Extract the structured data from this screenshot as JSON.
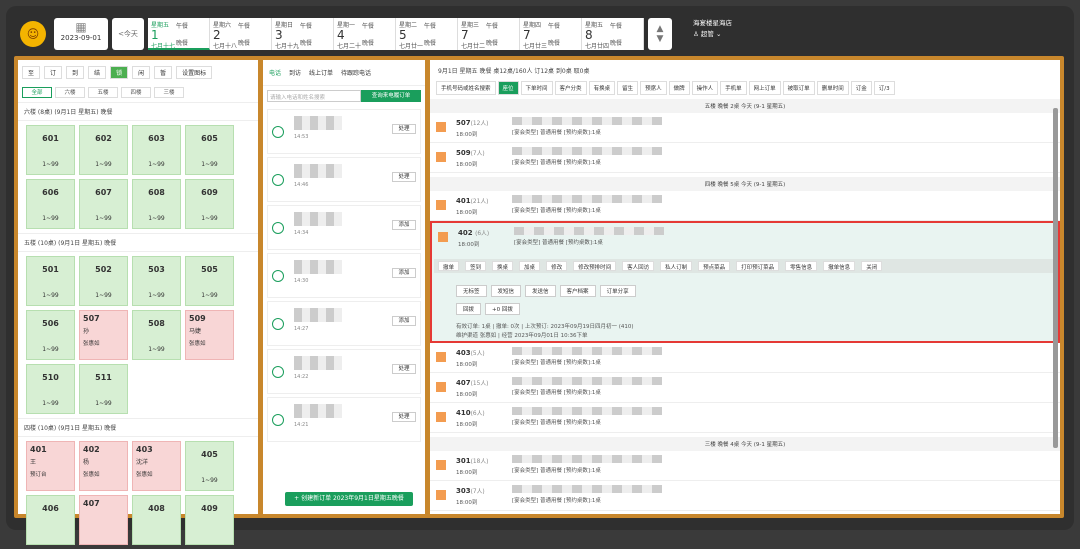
{
  "date": "2023-09-01",
  "today_label": "<今天",
  "days": [
    {
      "wk": "星期五",
      "num": "1",
      "lun": "七月十七",
      "m1": "午餐",
      "m2": "晚餐",
      "active": true
    },
    {
      "wk": "星期六",
      "num": "2",
      "lun": "七月十八",
      "m1": "午餐",
      "m2": "晚餐"
    },
    {
      "wk": "星期日",
      "num": "3",
      "lun": "七月十九",
      "m1": "午餐",
      "m2": "晚餐"
    },
    {
      "wk": "星期一",
      "num": "4",
      "lun": "七月二十",
      "m1": "午餐",
      "m2": "晚餐"
    },
    {
      "wk": "星期二",
      "num": "5",
      "lun": "七月廿一",
      "m1": "午餐",
      "m2": "晚餐"
    },
    {
      "wk": "星期三",
      "num": "7",
      "lun": "七月廿二",
      "m1": "午餐",
      "m2": "晚餐"
    },
    {
      "wk": "星期四",
      "num": "7",
      "lun": "七月廿三",
      "m1": "午餐",
      "m2": "晚餐"
    },
    {
      "wk": "星期五",
      "num": "8",
      "lun": "七月廿四",
      "m1": "午餐",
      "m2": "晚餐"
    }
  ],
  "store": {
    "name": "海宴楼星海店",
    "user": "超管"
  },
  "left": {
    "chips": [
      "至",
      "订",
      "到",
      "结",
      "锁",
      "闲",
      "暂",
      "设置图标"
    ],
    "floors": [
      "全部",
      "六楼",
      "五楼",
      "四楼",
      "三楼"
    ],
    "sec1": "六楼 (8桌) (9月1日 星期五) 晚餐",
    "sec2": "五楼 (10桌) (9月1日 星期五) 晚餐",
    "sec3": "四楼 (10桌) (9月1日 星期五) 晚餐",
    "tables1": [
      {
        "n": "601",
        "c": "1~99"
      },
      {
        "n": "602",
        "c": "1~99"
      },
      {
        "n": "603",
        "c": "1~99"
      },
      {
        "n": "605",
        "c": "1~99"
      },
      {
        "n": "606",
        "c": "1~99"
      },
      {
        "n": "607",
        "c": "1~99"
      },
      {
        "n": "608",
        "c": "1~99"
      },
      {
        "n": "609",
        "c": "1~99"
      }
    ],
    "tables2": [
      {
        "n": "501",
        "c": "1~99"
      },
      {
        "n": "502",
        "c": "1~99"
      },
      {
        "n": "503",
        "c": "1~99"
      },
      {
        "n": "505",
        "c": "1~99"
      },
      {
        "n": "506",
        "c": "1~99"
      },
      {
        "n": "507",
        "who": "孙",
        "ph": "张惠如",
        "r": true
      },
      {
        "n": "508",
        "c": "1~99"
      },
      {
        "n": "509",
        "who": "马婕",
        "ph": "张惠如",
        "r": true
      },
      {
        "n": "510",
        "c": "1~99"
      },
      {
        "n": "511",
        "c": "1~99"
      }
    ],
    "tables3": [
      {
        "n": "401",
        "who": "王",
        "ph": "预订台",
        "r": true
      },
      {
        "n": "402",
        "who": "杨",
        "ph": "张惠如",
        "r": true
      },
      {
        "n": "403",
        "who": "沈洋",
        "ph": "张惠如",
        "r": true
      },
      {
        "n": "405",
        "c": "1~99"
      },
      {
        "n": "406",
        "c": ""
      },
      {
        "n": "407",
        "who": "",
        "ph": "",
        "r": true
      },
      {
        "n": "408",
        "c": ""
      },
      {
        "n": "409",
        "c": ""
      }
    ]
  },
  "mid": {
    "tabs": [
      "电话",
      "到访",
      "线上订单",
      "待跟踪电话"
    ],
    "search_ph": "请输入电话和姓名搜索",
    "search_btn": "查询来电履订单",
    "calls": [
      {
        "t": "14:53",
        "a": "处理"
      },
      {
        "t": "14:46",
        "a": "处理"
      },
      {
        "t": "14:34",
        "a": "添加"
      },
      {
        "t": "14:30",
        "a": "添加"
      },
      {
        "t": "14:27",
        "a": "添加"
      },
      {
        "t": "14:22",
        "a": "处理"
      },
      {
        "t": "14:21",
        "a": "处理"
      }
    ],
    "new_btn": "创建新订单 2023年9月1日星期五晚餐"
  },
  "right": {
    "header": "9月1日 星期五 晚餐 桌12桌/160人 订12桌 到0桌 取0桌",
    "tabs": [
      "手机号码或姓名搜索",
      "座位",
      "下单时间",
      "客户分类",
      "有换桌",
      "留生",
      "预席人",
      "做牌",
      "操作人",
      "手机单",
      "网上订单",
      "被取订单",
      "删单时间",
      "订金",
      "订/3"
    ],
    "g1": "五楼 晚餐 2桌 今天 (9-1 星期五)",
    "g2": "四楼 晚餐 5桌 今天 (9-1 星期五)",
    "g3": "三楼 晚餐 4桌 今天 (9-1 星期五)",
    "rows1": [
      {
        "n": "507",
        "p": "(12人)",
        "t": "18:00到"
      },
      {
        "n": "509",
        "p": "(7人)",
        "t": "18:00到"
      }
    ],
    "rows2": [
      {
        "n": "401",
        "p": "(21人)",
        "t": "18:00到"
      }
    ],
    "sel": {
      "n": "402",
      "p": "(6人)",
      "t": "18:00到"
    },
    "rows3": [
      {
        "n": "403",
        "p": "(5人)",
        "t": "18:00到"
      },
      {
        "n": "407",
        "p": "(15人)",
        "t": "18:00到"
      },
      {
        "n": "410",
        "p": "(6人)",
        "t": "18:00到"
      }
    ],
    "rows4": [
      {
        "n": "301",
        "p": "(18人)",
        "t": "18:00到"
      },
      {
        "n": "303",
        "p": "(7人)",
        "t": "18:00到"
      }
    ],
    "rowtext": "[宴会类型] 普通用餐 [预约桌数]:1桌",
    "ops": [
      "撤单",
      "签到",
      "换桌",
      "加桌",
      "修改",
      "修改预排时间",
      "客人回访",
      "私人订制",
      "预点菜品",
      "打印预订菜品",
      "零售信息",
      "撤单信息",
      "关闭"
    ],
    "sub1": [
      "无标签",
      "发短信",
      "发送信",
      "客户档案",
      "订单分享"
    ],
    "sub2": [
      "回拨",
      "+0 回拨"
    ],
    "info1": "有效订单: 1桌 | 撤单: 0次 | 上次预订: 2023年09月19日四月初一 (410)",
    "info2": "维护渠道 张惠如 | 经营 2023年09月01日 10:36下单"
  }
}
